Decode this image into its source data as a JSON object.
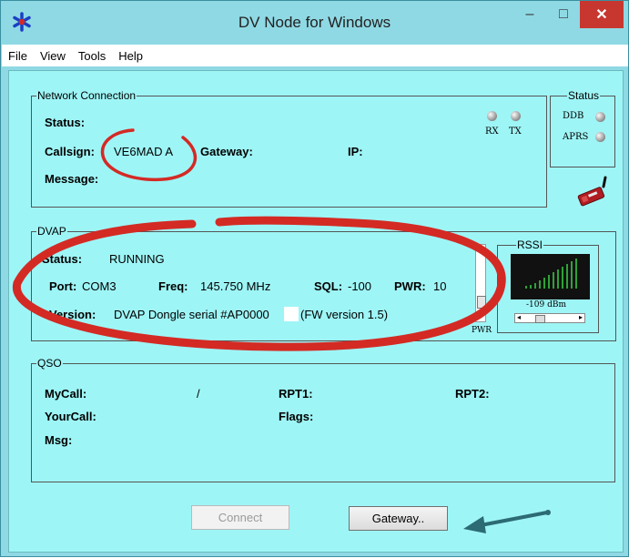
{
  "window": {
    "title": "DV Node for Windows",
    "icon": "asterisk-icon",
    "controls": {
      "minimize": "–",
      "maximize": "□",
      "close": "✕"
    }
  },
  "menu": [
    "File",
    "View",
    "Tools",
    "Help"
  ],
  "network_connection": {
    "legend": "Network Connection",
    "status_label": "Status:",
    "status_value": "",
    "callsign_label": "Callsign:",
    "callsign_value": "VE6MAD A",
    "gateway_label": "Gateway:",
    "gateway_value": "",
    "ip_label": "IP:",
    "ip_value": "",
    "message_label": "Message:",
    "message_value": "",
    "rx_label": "RX",
    "tx_label": "TX"
  },
  "status_box": {
    "legend": "Status",
    "ddb_label": "DDB",
    "aprs_label": "APRS"
  },
  "dvap": {
    "legend": "DVAP",
    "status_label": "Status:",
    "status_value": "RUNNING",
    "port_label": "Port:",
    "port_value": "COM3",
    "freq_label": "Freq:",
    "freq_value": "145.750 MHz",
    "sql_label": "SQL:",
    "sql_value": "-100",
    "pwr_label": "PWR:",
    "pwr_value": "10",
    "version_label": "Version:",
    "version_value": "DVAP Dongle serial #AP0000",
    "fw_value": "(FW version 1.5)",
    "pwr_slider_label": "PWR"
  },
  "rssi": {
    "legend": "RSSI",
    "value_text": "-109 dBm"
  },
  "qso": {
    "legend": "QSO",
    "mycall_label": "MyCall:",
    "mycall_sep": "/",
    "rpt1_label": "RPT1:",
    "rpt2_label": "RPT2:",
    "yourcall_label": "YourCall:",
    "flags_label": "Flags:",
    "msg_label": "Msg:"
  },
  "buttons": {
    "connect": "Connect",
    "gateway": "Gateway.."
  },
  "colors": {
    "background": "#9ef5f6",
    "titlebar": "#8fd9e4",
    "close": "#c7372f",
    "annotation": "#d42a24",
    "arrow": "#2c6b73",
    "meter": "#2fa13a"
  }
}
